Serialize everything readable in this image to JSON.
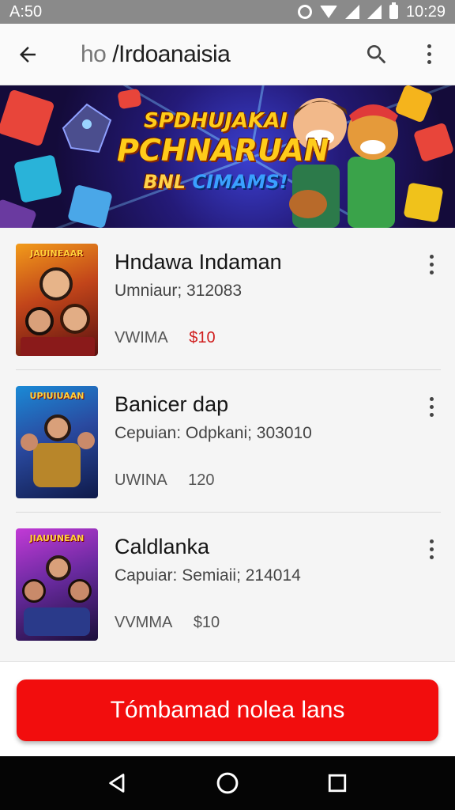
{
  "status_bar": {
    "time_left": "A:50",
    "time_right": "10:29"
  },
  "app_bar": {
    "title_prefix": "ho",
    "title": "/Irdoanaisia"
  },
  "banner": {
    "line1": "SPDHUJAKAI",
    "line2": "PCHNARUAN",
    "line3_a": "BNL",
    "line3_b": "CIMAMS!"
  },
  "items": [
    {
      "thumb_title": "JAUINEAAR",
      "title": "Hndawa Indaman",
      "subtitle": "Umniaur; 312083",
      "meta_label": "VWIMA",
      "price": "$10",
      "price_color": "#d01d1d"
    },
    {
      "thumb_title": "UPIUIUAAN",
      "title": "Banicer dap",
      "subtitle": "Cepuian: Odpkani; 303010",
      "meta_label": "UWINA",
      "price": "120",
      "price_color": "#555555"
    },
    {
      "thumb_title": "JIAUUNEAN",
      "title": "Caldlanka",
      "subtitle": "Capuiar: Semiaii; 214014",
      "meta_label": "VVMMA",
      "price": "$10",
      "price_color": "#555555"
    }
  ],
  "cta": {
    "label": "Tómbamad nolea lans",
    "color": "#f20d0d"
  },
  "icons": {
    "back": "arrow-left-icon",
    "search": "search-icon",
    "menu": "more-vert-icon",
    "nav_back": "triangle-back-icon",
    "nav_home": "circle-home-icon",
    "nav_recents": "square-recents-icon"
  }
}
